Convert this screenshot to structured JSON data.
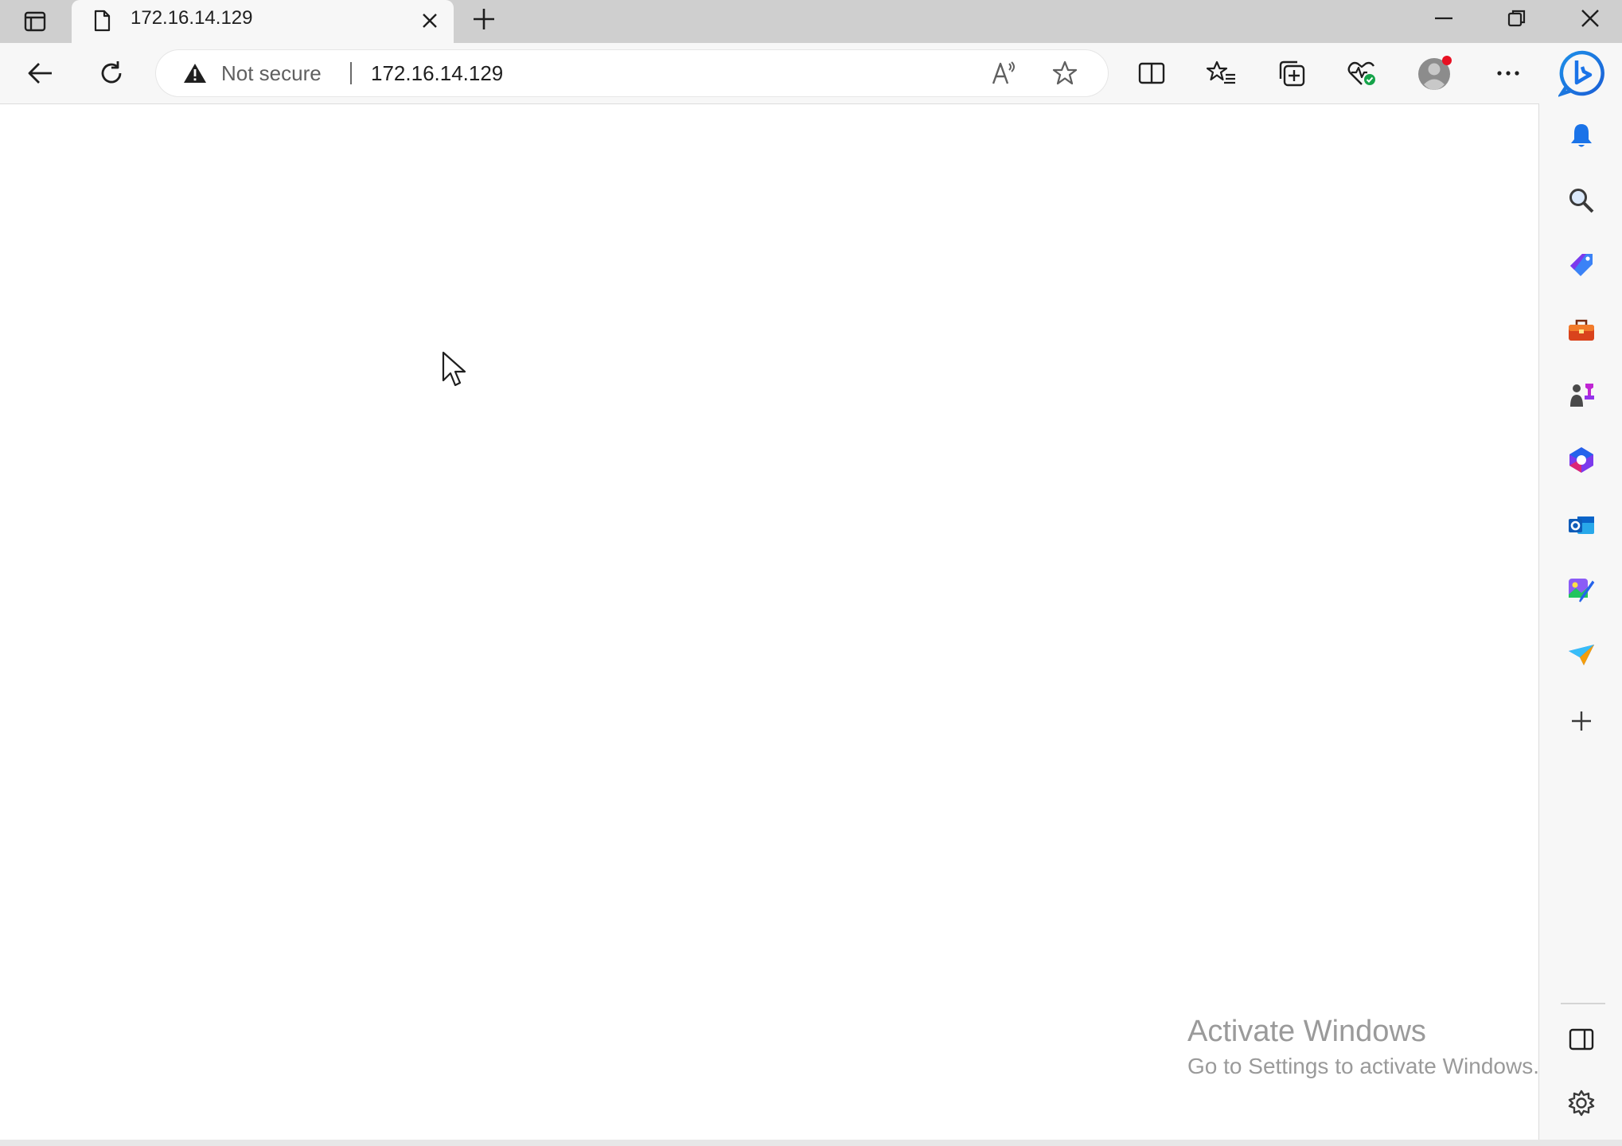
{
  "tab": {
    "title": "172.16.14.129",
    "favicon": "page-icon",
    "close_icon": "close-icon"
  },
  "titlebar": {
    "tab_actions_icon": "tab-actions-icon",
    "new_tab_icon": "plus-icon",
    "minimize_icon": "minimize-icon",
    "restore_icon": "restore-icon",
    "close_icon": "close-icon"
  },
  "toolbar": {
    "back_icon": "back-arrow-icon",
    "refresh_icon": "refresh-icon",
    "security_label": "Not secure",
    "url": "172.16.14.129",
    "read_aloud_icon": "read-aloud-icon",
    "favorite_icon": "star-icon",
    "split_screen_icon": "split-screen-icon",
    "favorites_icon": "favorites-icon",
    "collections_icon": "collections-icon",
    "performance_icon": "browser-essentials-icon",
    "profile_icon": "avatar",
    "menu_icon": "more-icon",
    "copilot_icon": "bing-icon"
  },
  "sidebar": {
    "items": [
      {
        "name": "notifications-icon"
      },
      {
        "name": "search-icon"
      },
      {
        "name": "shopping-icon"
      },
      {
        "name": "tools-icon"
      },
      {
        "name": "games-icon"
      },
      {
        "name": "microsoft-365-icon"
      },
      {
        "name": "outlook-icon"
      },
      {
        "name": "designer-icon"
      },
      {
        "name": "drop-icon"
      },
      {
        "name": "add-icon"
      }
    ],
    "bottom": [
      {
        "name": "hide-sidebar-icon"
      },
      {
        "name": "settings-icon"
      }
    ]
  },
  "watermark": {
    "line1": "Activate Windows",
    "line2": "Go to Settings to activate Windows."
  },
  "colors": {
    "accent_blue": "#1a73e8",
    "notification_dot": "#e81123"
  }
}
